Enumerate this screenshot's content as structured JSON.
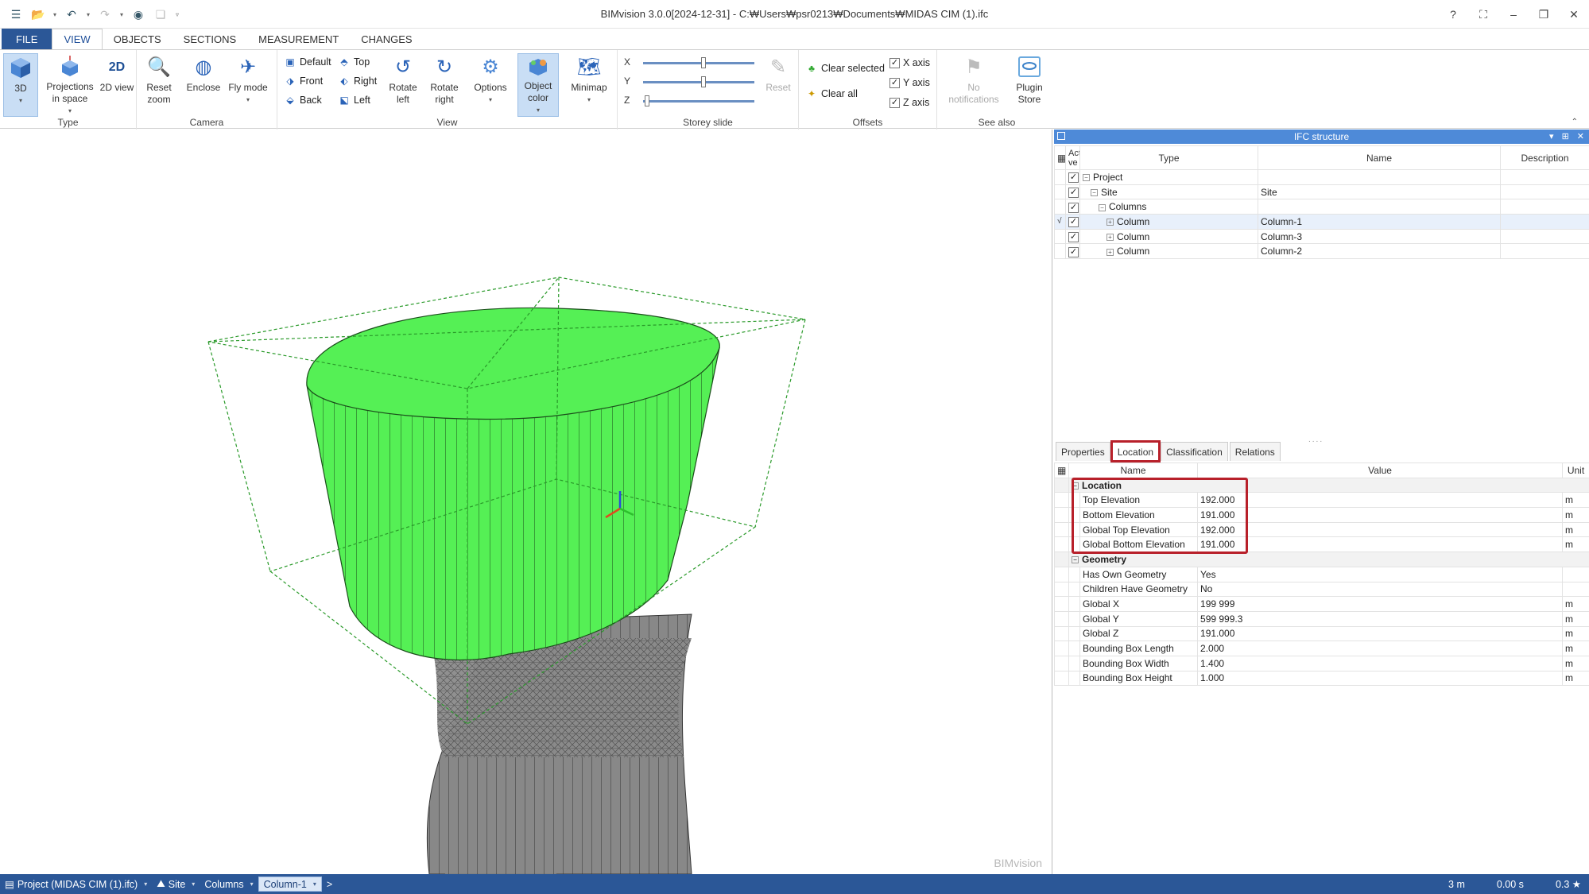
{
  "window": {
    "title": "BIMvision 3.0.0[2024-12-31] - C:₩Users₩psr0213₩Documents₩MIDAS CIM (1).ifc",
    "controls": [
      "?",
      "⛶",
      "–",
      "❐",
      "✕"
    ]
  },
  "tabs": [
    "FILE",
    "VIEW",
    "OBJECTS",
    "SECTIONS",
    "MEASUREMENT",
    "CHANGES"
  ],
  "ribbon": {
    "type": {
      "label": "Type",
      "b3d": "3D",
      "proj": "Projections in space",
      "v2d": "2D view"
    },
    "camera": {
      "label": "Camera",
      "reset": "Reset zoom",
      "enclose": "Enclose",
      "fly": "Fly mode"
    },
    "view": {
      "label": "View",
      "default": "Default",
      "top": "Top",
      "front": "Front",
      "right": "Right",
      "back": "Back",
      "left": "Left",
      "rotl": "Rotate left",
      "rotr": "Rotate right",
      "options": "Options",
      "objcolor": "Object color",
      "minimap": "Minimap"
    },
    "storey": {
      "label": "Storey slide",
      "x": "X",
      "y": "Y",
      "z": "Z",
      "reset": "Reset"
    },
    "offsets": {
      "label": "Offsets",
      "clear_selected": "Clear selected",
      "clear_all": "Clear all",
      "xaxis": "X axis",
      "yaxis": "Y axis",
      "zaxis": "Z axis"
    },
    "seealso": {
      "label": "See also",
      "notif": "No notifications",
      "plugin": "Plugin Store"
    }
  },
  "ifc": {
    "title": "IFC structure",
    "cols": [
      "Acti ve",
      "Type",
      "Name",
      "Description"
    ],
    "rows": [
      {
        "type": "Project",
        "name": "",
        "level": 0,
        "sign": "−"
      },
      {
        "type": "Site",
        "name": "Site",
        "level": 1,
        "sign": "−"
      },
      {
        "type": "Columns",
        "name": "",
        "level": 2,
        "sign": "−"
      },
      {
        "type": "Column",
        "name": "Column-1",
        "level": 3,
        "sign": "+",
        "mark": "√"
      },
      {
        "type": "Column",
        "name": "Column-3",
        "level": 3,
        "sign": "+"
      },
      {
        "type": "Column",
        "name": "Column-2",
        "level": 3,
        "sign": "+"
      }
    ]
  },
  "props": {
    "tabs": [
      "Properties",
      "Location",
      "Classification",
      "Relations"
    ],
    "cols": [
      "Name",
      "Value",
      "Unit"
    ],
    "location": {
      "title": "Location",
      "rows": [
        [
          "Top Elevation",
          "192.000",
          "m"
        ],
        [
          "Bottom Elevation",
          "191.000",
          "m"
        ],
        [
          "Global Top Elevation",
          "192.000",
          "m"
        ],
        [
          "Global Bottom Elevation",
          "191.000",
          "m"
        ]
      ]
    },
    "geometry": {
      "title": "Geometry",
      "rows": [
        [
          "Has Own Geometry",
          "Yes",
          ""
        ],
        [
          "Children Have Geometry",
          "No",
          ""
        ],
        [
          "Global X",
          "199 999",
          "m"
        ],
        [
          "Global Y",
          "599 999.3",
          "m"
        ],
        [
          "Global Z",
          "191.000",
          "m"
        ],
        [
          "Bounding Box Length",
          "2.000",
          "m"
        ],
        [
          "Bounding Box Width",
          "1.400",
          "m"
        ],
        [
          "Bounding Box Height",
          "1.000",
          "m"
        ]
      ]
    }
  },
  "viewport": {
    "watermark": "BIMvision"
  },
  "status": {
    "crumbs": [
      "Project (MIDAS CIM (1).ifc)",
      "Site",
      "Columns",
      "Column-1"
    ],
    "more": ">",
    "scale": "3 m",
    "time": "0.00 s",
    "zoom": "0.3 ★"
  },
  "colors": {
    "accent": "#2b5797",
    "highlight": "#b8202a",
    "selected": "#55f055"
  }
}
